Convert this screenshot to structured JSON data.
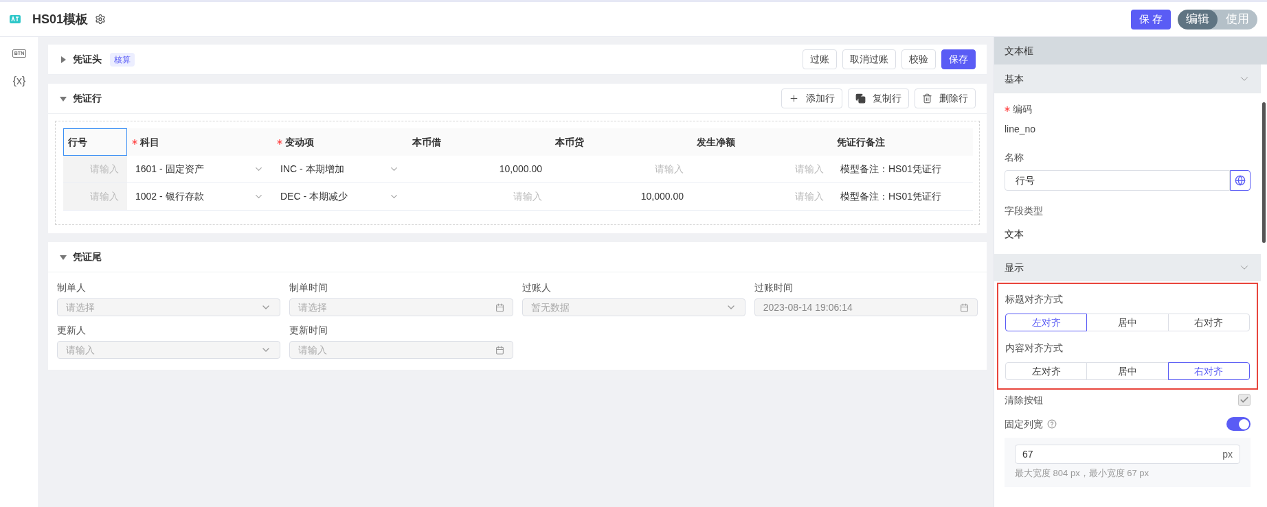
{
  "topbar": {
    "title": "HS01模板",
    "save": "保 存",
    "modes": [
      {
        "label": "编辑",
        "selected": true
      },
      {
        "label": "使用",
        "selected": false
      }
    ]
  },
  "rail": [
    {
      "label": "BTN",
      "kind": "badge"
    },
    {
      "label": "{x}",
      "kind": "plain"
    }
  ],
  "voucher_head": {
    "title": "凭证头",
    "expanded": false,
    "tag": "核算",
    "actions": [
      {
        "label": "过账",
        "kind": "default"
      },
      {
        "label": "取消过账",
        "kind": "default"
      },
      {
        "label": "校验",
        "kind": "default"
      },
      {
        "label": "保存",
        "kind": "primary"
      }
    ]
  },
  "voucher_lines": {
    "title": "凭证行",
    "expanded": true,
    "actions": [
      {
        "label": "添加行",
        "kind": "add"
      },
      {
        "label": "复制行",
        "kind": "copy"
      },
      {
        "label": "删除行",
        "kind": "delete"
      }
    ],
    "table": {
      "columns": [
        {
          "label": "行号",
          "required": false,
          "selected": true
        },
        {
          "label": "科目",
          "required": true,
          "selected": false
        },
        {
          "label": "变动项",
          "required": true,
          "selected": false
        },
        {
          "label": "本币借",
          "required": false,
          "selected": false
        },
        {
          "label": "本币贷",
          "required": false,
          "selected": false
        },
        {
          "label": "发生净额",
          "required": false,
          "selected": false
        },
        {
          "label": "凭证行备注",
          "required": false,
          "selected": false
        }
      ],
      "rows": [
        {
          "cells": [
            {
              "kind": "input",
              "placeholder": "请输入",
              "disabled": true
            },
            {
              "kind": "select",
              "value": "1601 - 固定资产"
            },
            {
              "kind": "select",
              "value": "INC - 本期增加"
            },
            {
              "kind": "input",
              "value": "10,000.00",
              "disabled": false
            },
            {
              "kind": "input",
              "placeholder": "请输入",
              "disabled": false
            },
            {
              "kind": "input",
              "placeholder": "请输入",
              "disabled": false
            },
            {
              "kind": "text",
              "value": "模型备注：HS01凭证行"
            }
          ]
        },
        {
          "cells": [
            {
              "kind": "input",
              "placeholder": "请输入",
              "disabled": true
            },
            {
              "kind": "select",
              "value": "1002 - 银行存款"
            },
            {
              "kind": "select",
              "value": "DEC - 本期减少"
            },
            {
              "kind": "input",
              "placeholder": "请输入",
              "disabled": false
            },
            {
              "kind": "input",
              "value": "10,000.00",
              "disabled": false
            },
            {
              "kind": "input",
              "placeholder": "请输入",
              "disabled": false
            },
            {
              "kind": "text",
              "value": "模型备注：HS01凭证行"
            }
          ]
        }
      ]
    }
  },
  "voucher_tail": {
    "title": "凭证尾",
    "expanded": true,
    "fields": [
      {
        "label": "制单人",
        "kind": "select",
        "placeholder": "请选择",
        "disabled": true
      },
      {
        "label": "制单时间",
        "kind": "date",
        "placeholder": "请选择",
        "disabled": true
      },
      {
        "label": "过账人",
        "kind": "select",
        "placeholder": "暂无数据",
        "disabled": true
      },
      {
        "label": "过账时间",
        "kind": "date",
        "value": "2023-08-14 19:06:14",
        "disabled": true
      },
      {
        "label": "更新人",
        "kind": "select",
        "placeholder": "请输入",
        "disabled": true
      },
      {
        "label": "更新时间",
        "kind": "date",
        "placeholder": "请输入",
        "disabled": true
      }
    ]
  },
  "properties": {
    "title": "文本框",
    "basic": {
      "title": "基本",
      "expanded": true,
      "code_label": "编码",
      "code_required": true,
      "code_value": "line_no",
      "name_label": "名称",
      "name_value": "行号",
      "type_label": "字段类型",
      "type_value": "文本"
    },
    "display": {
      "title": "显示",
      "expanded": true,
      "highlighted": true,
      "title_align": {
        "label": "标题对齐方式",
        "options": [
          {
            "label": "左对齐",
            "selected": true
          },
          {
            "label": "居中",
            "selected": false
          },
          {
            "label": "右对齐",
            "selected": false
          }
        ]
      },
      "content_align": {
        "label": "内容对齐方式",
        "options": [
          {
            "label": "左对齐",
            "selected": false
          },
          {
            "label": "居中",
            "selected": false
          },
          {
            "label": "右对齐",
            "selected": true
          }
        ]
      },
      "clear_button": {
        "label": "清除按钮",
        "checked": true
      },
      "fixed_width": {
        "label": "固定列宽",
        "on": true,
        "value": "67",
        "unit": "px",
        "hint": "最大宽度 804 px，最小宽度 67 px"
      }
    }
  }
}
